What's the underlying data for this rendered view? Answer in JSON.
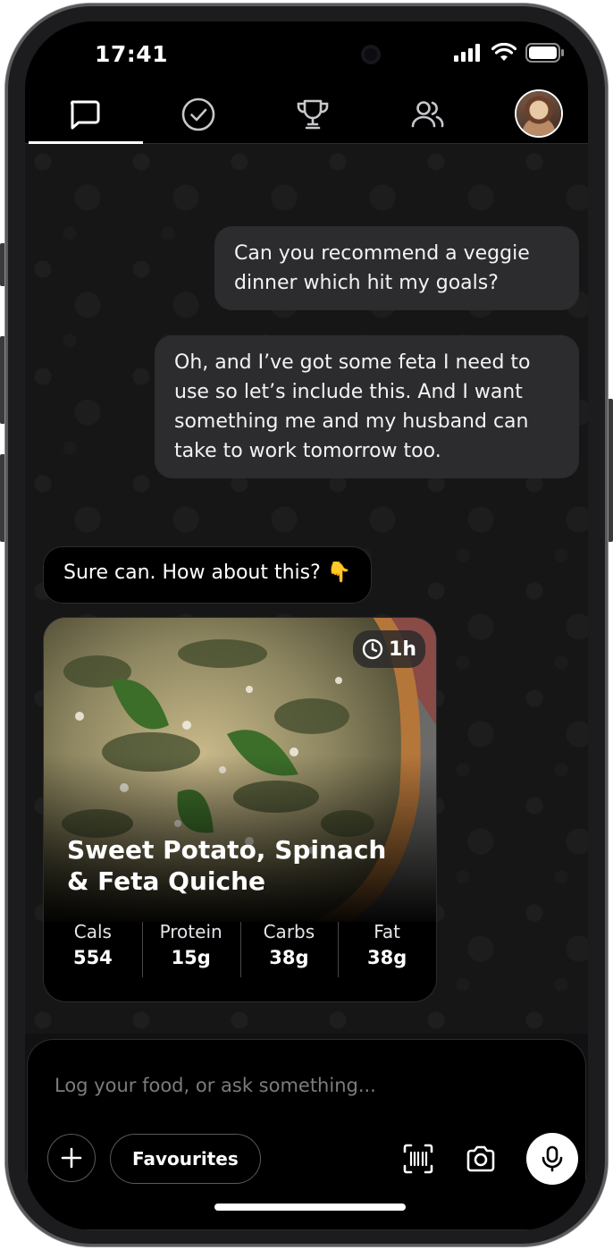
{
  "status_bar": {
    "time": "17:41"
  },
  "nav": {
    "tabs": [
      {
        "id": "chat",
        "icon": "chat-bubble-icon",
        "active": true
      },
      {
        "id": "tasks",
        "icon": "check-circle-icon",
        "active": false
      },
      {
        "id": "achievements",
        "icon": "trophy-icon",
        "active": false
      },
      {
        "id": "community",
        "icon": "people-icon",
        "active": false
      }
    ]
  },
  "messages": [
    {
      "from": "user",
      "text": "Can you recommend a veggie dinner which hit my goals?"
    },
    {
      "from": "user",
      "text": "Oh, and I’ve got some feta I need to use so let’s include this. And I want something me and my husband can take to work tomorrow too."
    },
    {
      "from": "assistant",
      "text": "Sure can. How about this? 👇"
    }
  ],
  "recipe": {
    "title": "Sweet Potato, Spinach & Feta Quiche",
    "duration": "1h",
    "macros": [
      {
        "label": "Cals",
        "value": "554"
      },
      {
        "label": "Protein",
        "value": "15g"
      },
      {
        "label": "Carbs",
        "value": "38g"
      },
      {
        "label": "Fat",
        "value": "38g"
      }
    ]
  },
  "composer": {
    "placeholder": "Log your food, or ask something...",
    "favourites_label": "Favourites"
  },
  "colors": {
    "background": "#111113",
    "user_bubble": "#2c2c2e",
    "assistant_bubble": "#000000",
    "accent": "#ffffff"
  }
}
